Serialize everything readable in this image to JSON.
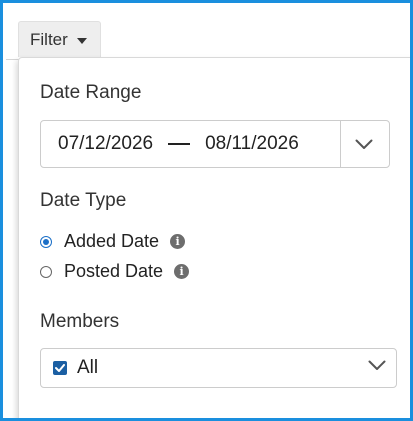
{
  "filter_button": {
    "label": "Filter"
  },
  "panel": {
    "date_range": {
      "label": "Date Range",
      "start": "07/12/2026",
      "end": "08/11/2026"
    },
    "date_type": {
      "label": "Date Type",
      "options": [
        {
          "label": "Added Date",
          "selected": true
        },
        {
          "label": "Posted Date",
          "selected": false
        }
      ]
    },
    "members": {
      "label": "Members",
      "value": "All",
      "checked": true
    }
  },
  "colors": {
    "frame_border": "#1a8fde",
    "accent": "#1b6fc7",
    "checkbox": "#1b5fa3"
  },
  "icons": [
    "caret-down-icon",
    "chevron-down-icon",
    "info-icon",
    "check-icon"
  ]
}
